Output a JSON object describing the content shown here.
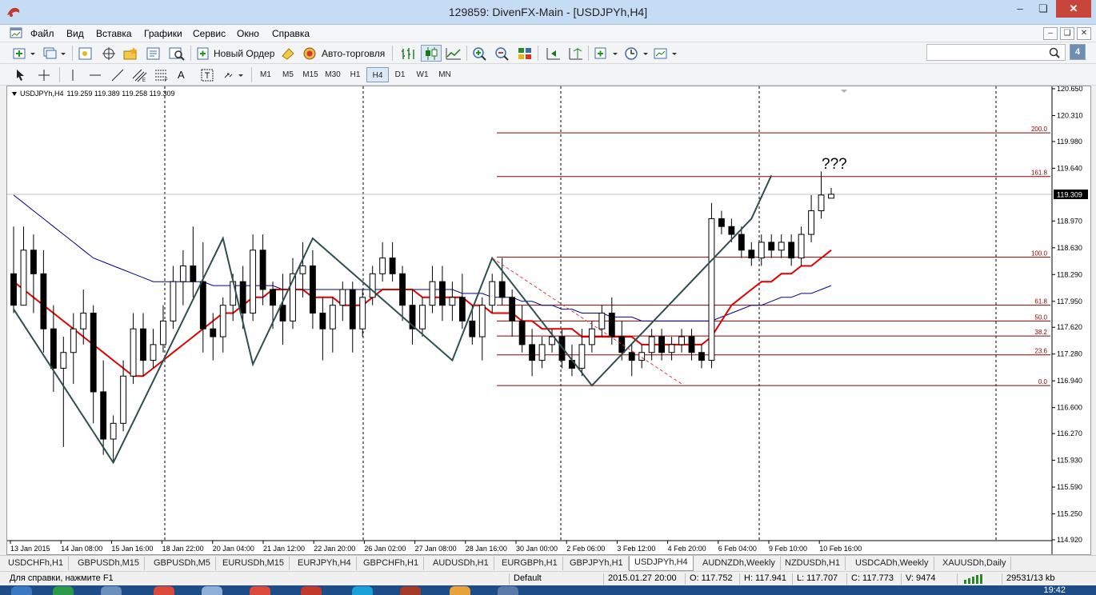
{
  "window": {
    "title": "129859: DivenFX-Main - [USDJPYh,H4]"
  },
  "menu": [
    "Файл",
    "Вид",
    "Вставка",
    "Графики",
    "Сервис",
    "Окно",
    "Справка"
  ],
  "toolbar": {
    "new_order": "Новый Ордер",
    "auto_trading": "Авто-торговля",
    "help_count": "4"
  },
  "timeframes": [
    "M1",
    "M5",
    "M15",
    "M30",
    "H1",
    "H4",
    "D1",
    "W1",
    "MN"
  ],
  "active_timeframe": "H4",
  "chart": {
    "symbol_header": "USDJPYh,H4",
    "ohlc_header": "119.259 119.389 119.258 119.309",
    "current_price": "119.309",
    "annotation": "???",
    "fib_levels": [
      {
        "label": "200.0",
        "price": 120.09
      },
      {
        "label": "161.8",
        "price": 119.535
      },
      {
        "label": "100.0",
        "price": 118.51
      },
      {
        "label": "61.8",
        "price": 117.9
      },
      {
        "label": "50.0",
        "price": 117.7
      },
      {
        "label": "38.2",
        "price": 117.51
      },
      {
        "label": "23.6",
        "price": 117.27
      },
      {
        "label": "0.0",
        "price": 116.88
      }
    ]
  },
  "chart_data": {
    "type": "candlestick",
    "y_ticks": [
      "120.650",
      "120.310",
      "119.980",
      "119.640",
      "119.309",
      "118.970",
      "118.630",
      "118.290",
      "117.950",
      "117.620",
      "117.280",
      "116.940",
      "116.600",
      "116.270",
      "115.930",
      "115.590",
      "115.250",
      "114.920"
    ],
    "ylim": [
      114.92,
      120.65
    ],
    "x_ticks": [
      "13 Jan 2015",
      "14 Jan 08:00",
      "15 Jan 16:00",
      "18 Jan 22:00",
      "20 Jan 04:00",
      "21 Jan 12:00",
      "22 Jan 20:00",
      "26 Jan 02:00",
      "27 Jan 08:00",
      "28 Jan 16:00",
      "30 Jan 00:00",
      "2 Feb 06:00",
      "3 Feb 12:00",
      "4 Feb 20:00",
      "6 Feb 04:00",
      "9 Feb 10:00",
      "10 Feb 16:00"
    ],
    "candles": [
      {
        "o": 118.3,
        "h": 118.9,
        "l": 117.8,
        "c": 117.9
      },
      {
        "o": 117.9,
        "h": 118.9,
        "l": 117.9,
        "c": 118.6
      },
      {
        "o": 118.6,
        "h": 118.8,
        "l": 117.8,
        "c": 118.3
      },
      {
        "o": 118.3,
        "h": 118.6,
        "l": 117.3,
        "c": 117.6
      },
      {
        "o": 117.6,
        "h": 117.9,
        "l": 116.8,
        "c": 117.1
      },
      {
        "o": 117.1,
        "h": 117.5,
        "l": 116.1,
        "c": 117.3
      },
      {
        "o": 117.3,
        "h": 117.8,
        "l": 116.9,
        "c": 117.6
      },
      {
        "o": 117.6,
        "h": 118.1,
        "l": 117.4,
        "c": 117.8
      },
      {
        "o": 117.8,
        "h": 117.9,
        "l": 116.4,
        "c": 116.8
      },
      {
        "o": 116.8,
        "h": 117.2,
        "l": 116.0,
        "c": 116.2
      },
      {
        "o": 116.2,
        "h": 116.5,
        "l": 115.9,
        "c": 116.4
      },
      {
        "o": 116.4,
        "h": 117.2,
        "l": 116.3,
        "c": 117.0
      },
      {
        "o": 117.0,
        "h": 117.8,
        "l": 116.9,
        "c": 117.6
      },
      {
        "o": 117.6,
        "h": 117.8,
        "l": 117.0,
        "c": 117.2
      },
      {
        "o": 117.2,
        "h": 117.6,
        "l": 117.1,
        "c": 117.4
      },
      {
        "o": 117.4,
        "h": 117.9,
        "l": 117.3,
        "c": 117.7
      },
      {
        "o": 117.7,
        "h": 118.4,
        "l": 117.6,
        "c": 118.2
      },
      {
        "o": 118.2,
        "h": 118.6,
        "l": 117.9,
        "c": 118.4
      },
      {
        "o": 118.4,
        "h": 118.9,
        "l": 118.0,
        "c": 118.2
      },
      {
        "o": 118.2,
        "h": 118.7,
        "l": 117.3,
        "c": 117.6
      },
      {
        "o": 117.6,
        "h": 117.8,
        "l": 117.2,
        "c": 117.5
      },
      {
        "o": 117.5,
        "h": 118.0,
        "l": 117.3,
        "c": 117.9
      },
      {
        "o": 117.9,
        "h": 118.3,
        "l": 117.7,
        "c": 118.2
      },
      {
        "o": 118.2,
        "h": 118.4,
        "l": 117.6,
        "c": 117.8
      },
      {
        "o": 117.8,
        "h": 118.8,
        "l": 117.7,
        "c": 118.6
      },
      {
        "o": 118.6,
        "h": 118.8,
        "l": 117.9,
        "c": 118.1
      },
      {
        "o": 118.1,
        "h": 118.2,
        "l": 117.6,
        "c": 117.9
      },
      {
        "o": 117.9,
        "h": 118.3,
        "l": 117.4,
        "c": 117.7
      },
      {
        "o": 117.7,
        "h": 118.5,
        "l": 117.6,
        "c": 118.3
      },
      {
        "o": 118.3,
        "h": 118.7,
        "l": 118.0,
        "c": 118.4
      },
      {
        "o": 118.4,
        "h": 118.6,
        "l": 117.6,
        "c": 117.8
      },
      {
        "o": 117.8,
        "h": 118.0,
        "l": 117.2,
        "c": 117.6
      },
      {
        "o": 117.6,
        "h": 118.0,
        "l": 117.3,
        "c": 117.9
      },
      {
        "o": 117.9,
        "h": 118.2,
        "l": 117.7,
        "c": 118.1
      },
      {
        "o": 118.1,
        "h": 118.2,
        "l": 117.3,
        "c": 117.6
      },
      {
        "o": 117.6,
        "h": 118.1,
        "l": 117.5,
        "c": 118.0
      },
      {
        "o": 118.0,
        "h": 118.4,
        "l": 117.9,
        "c": 118.3
      },
      {
        "o": 118.3,
        "h": 118.7,
        "l": 118.2,
        "c": 118.5
      },
      {
        "o": 118.5,
        "h": 118.7,
        "l": 118.2,
        "c": 118.3
      },
      {
        "o": 118.3,
        "h": 118.4,
        "l": 117.7,
        "c": 117.9
      },
      {
        "o": 117.9,
        "h": 118.1,
        "l": 117.4,
        "c": 117.6
      },
      {
        "o": 117.6,
        "h": 118.0,
        "l": 117.5,
        "c": 117.9
      },
      {
        "o": 117.9,
        "h": 118.4,
        "l": 117.8,
        "c": 118.2
      },
      {
        "o": 118.2,
        "h": 118.4,
        "l": 117.7,
        "c": 117.9
      },
      {
        "o": 117.9,
        "h": 118.2,
        "l": 117.7,
        "c": 118.0
      },
      {
        "o": 118.0,
        "h": 118.3,
        "l": 117.6,
        "c": 117.7
      },
      {
        "o": 117.7,
        "h": 117.9,
        "l": 117.4,
        "c": 117.5
      },
      {
        "o": 117.5,
        "h": 118.0,
        "l": 117.2,
        "c": 117.9
      },
      {
        "o": 117.9,
        "h": 118.3,
        "l": 117.8,
        "c": 118.2
      },
      {
        "o": 118.2,
        "h": 118.5,
        "l": 117.9,
        "c": 118.0
      },
      {
        "o": 118.0,
        "h": 118.1,
        "l": 117.5,
        "c": 117.7
      },
      {
        "o": 117.7,
        "h": 117.9,
        "l": 117.3,
        "c": 117.4
      },
      {
        "o": 117.4,
        "h": 117.6,
        "l": 117.0,
        "c": 117.2
      },
      {
        "o": 117.2,
        "h": 117.5,
        "l": 117.1,
        "c": 117.4
      },
      {
        "o": 117.4,
        "h": 117.6,
        "l": 117.3,
        "c": 117.5
      },
      {
        "o": 117.5,
        "h": 117.6,
        "l": 117.1,
        "c": 117.2
      },
      {
        "o": 117.2,
        "h": 117.4,
        "l": 117.0,
        "c": 117.1
      },
      {
        "o": 117.1,
        "h": 117.6,
        "l": 117.0,
        "c": 117.4
      },
      {
        "o": 117.4,
        "h": 117.7,
        "l": 117.3,
        "c": 117.6
      },
      {
        "o": 117.6,
        "h": 117.9,
        "l": 117.5,
        "c": 117.8
      },
      {
        "o": 117.8,
        "h": 118.0,
        "l": 117.4,
        "c": 117.5
      },
      {
        "o": 117.5,
        "h": 117.7,
        "l": 117.2,
        "c": 117.3
      },
      {
        "o": 117.3,
        "h": 117.4,
        "l": 117.0,
        "c": 117.2
      },
      {
        "o": 117.2,
        "h": 117.4,
        "l": 117.1,
        "c": 117.3
      },
      {
        "o": 117.3,
        "h": 117.6,
        "l": 117.2,
        "c": 117.5
      },
      {
        "o": 117.5,
        "h": 117.6,
        "l": 117.2,
        "c": 117.3
      },
      {
        "o": 117.3,
        "h": 117.5,
        "l": 117.2,
        "c": 117.4
      },
      {
        "o": 117.4,
        "h": 117.6,
        "l": 117.3,
        "c": 117.5
      },
      {
        "o": 117.5,
        "h": 117.6,
        "l": 117.2,
        "c": 117.3
      },
      {
        "o": 117.3,
        "h": 117.4,
        "l": 117.1,
        "c": 117.2
      },
      {
        "o": 117.2,
        "h": 119.2,
        "l": 117.1,
        "c": 119.0
      },
      {
        "o": 119.0,
        "h": 119.1,
        "l": 118.8,
        "c": 118.9
      },
      {
        "o": 118.9,
        "h": 119.0,
        "l": 118.7,
        "c": 118.8
      },
      {
        "o": 118.8,
        "h": 118.9,
        "l": 118.5,
        "c": 118.6
      },
      {
        "o": 118.6,
        "h": 118.7,
        "l": 118.4,
        "c": 118.5
      },
      {
        "o": 118.5,
        "h": 118.8,
        "l": 118.4,
        "c": 118.7
      },
      {
        "o": 118.7,
        "h": 118.8,
        "l": 118.5,
        "c": 118.6
      },
      {
        "o": 118.6,
        "h": 118.8,
        "l": 118.5,
        "c": 118.7
      },
      {
        "o": 118.7,
        "h": 118.8,
        "l": 118.4,
        "c": 118.5
      },
      {
        "o": 118.5,
        "h": 118.9,
        "l": 118.4,
        "c": 118.8
      },
      {
        "o": 118.8,
        "h": 119.3,
        "l": 118.7,
        "c": 119.1
      },
      {
        "o": 119.1,
        "h": 119.6,
        "l": 119.0,
        "c": 119.3
      },
      {
        "o": 119.26,
        "h": 119.39,
        "l": 119.26,
        "c": 119.31
      }
    ],
    "ma_red": [
      118.2,
      118.1,
      118.0,
      117.9,
      117.8,
      117.7,
      117.6,
      117.5,
      117.4,
      117.3,
      117.2,
      117.1,
      117.0,
      117.0,
      117.1,
      117.2,
      117.3,
      117.4,
      117.5,
      117.6,
      117.7,
      117.8,
      117.8,
      117.9,
      118.0,
      118.0,
      118.1,
      118.1,
      118.1,
      118.1,
      118.0,
      118.0,
      118.0,
      117.9,
      117.9,
      117.9,
      118.0,
      118.1,
      118.1,
      118.1,
      118.1,
      118.0,
      118.0,
      118.0,
      118.0,
      118.0,
      117.9,
      117.9,
      117.8,
      117.8,
      117.8,
      117.7,
      117.7,
      117.6,
      117.6,
      117.6,
      117.6,
      117.5,
      117.5,
      117.5,
      117.5,
      117.5,
      117.5,
      117.4,
      117.4,
      117.4,
      117.4,
      117.4,
      117.4,
      117.4,
      117.5,
      117.7,
      117.9,
      118.0,
      118.1,
      118.2,
      118.2,
      118.3,
      118.3,
      118.4,
      118.4,
      118.5,
      118.6
    ],
    "ma_blue": [
      119.3,
      119.2,
      119.1,
      119.0,
      118.9,
      118.8,
      118.7,
      118.6,
      118.5,
      118.45,
      118.4,
      118.35,
      118.3,
      118.25,
      118.2,
      118.2,
      118.2,
      118.2,
      118.2,
      118.2,
      118.15,
      118.15,
      118.15,
      118.15,
      118.15,
      118.15,
      118.15,
      118.1,
      118.1,
      118.1,
      118.1,
      118.1,
      118.1,
      118.1,
      118.1,
      118.1,
      118.1,
      118.1,
      118.1,
      118.1,
      118.1,
      118.1,
      118.1,
      118.1,
      118.1,
      118.05,
      118.05,
      118.05,
      118.0,
      118.0,
      118.0,
      117.95,
      117.95,
      117.9,
      117.9,
      117.85,
      117.85,
      117.8,
      117.8,
      117.8,
      117.75,
      117.75,
      117.75,
      117.7,
      117.7,
      117.7,
      117.7,
      117.7,
      117.7,
      117.7,
      117.7,
      117.75,
      117.8,
      117.85,
      117.9,
      117.9,
      117.95,
      118.0,
      118.0,
      118.05,
      118.05,
      118.1,
      118.15
    ]
  },
  "tabs": [
    "USDCHFh,H1",
    "GBPUSDh,M15",
    "GBPUSDh,M5",
    "EURUSDh,M15",
    "EURJPYh,H4",
    "GBPCHFh,H1",
    "AUDUSDh,H1",
    "EURGBPh,H1",
    "GBPJPYh,H1",
    "USDJPYh,H4",
    "AUDNZDh,Weekly",
    "NZDUSDh,H1",
    "USDCADh,Weekly",
    "XAUUSDh,Daily"
  ],
  "active_tab": "USDJPYh,H4",
  "status": {
    "help": "Для справки, нажмите F1",
    "profile": "Default",
    "datetime": "2015.01.27 20:00",
    "open": "O: 117.752",
    "high": "H: 117.941",
    "low": "L: 117.707",
    "close": "C: 117.773",
    "volume": "V: 9474",
    "traffic": "29531/13 kb"
  },
  "clock": "19:42"
}
